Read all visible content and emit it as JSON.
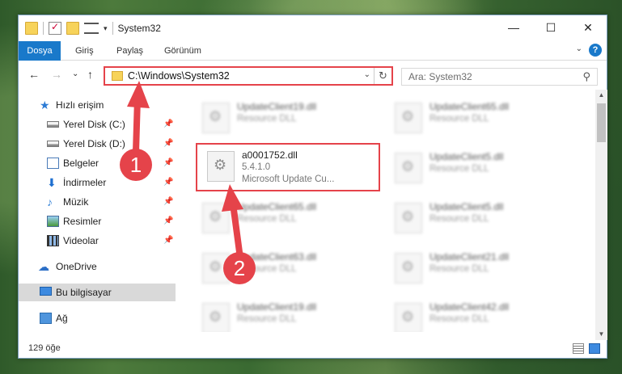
{
  "window": {
    "title": "System32",
    "controls": [
      "—",
      "☐",
      "✕"
    ]
  },
  "ribbon": {
    "tabs": [
      "Dosya",
      "Giriş",
      "Paylaş",
      "Görünüm"
    ]
  },
  "nav": {
    "back": "←",
    "forward": "→",
    "recent": "⌄",
    "up": "↑"
  },
  "address": {
    "path": "C:\\Windows\\System32"
  },
  "search": {
    "placeholder": "Ara: System32"
  },
  "sidebar": {
    "items": [
      {
        "label": "Hızlı erişim",
        "icon": "star-icon"
      },
      {
        "label": "Yerel Disk (C:)",
        "icon": "disk-icon",
        "pinned": true
      },
      {
        "label": "Yerel Disk (D:)",
        "icon": "disk-icon",
        "pinned": true
      },
      {
        "label": "Belgeler",
        "icon": "documents-icon",
        "pinned": true
      },
      {
        "label": "İndirmeler",
        "icon": "download-icon",
        "pinned": true
      },
      {
        "label": "Müzik",
        "icon": "music-icon",
        "pinned": true
      },
      {
        "label": "Resimler",
        "icon": "pictures-icon",
        "pinned": true
      },
      {
        "label": "Videolar",
        "icon": "videos-icon",
        "pinned": true
      },
      {
        "label": "OneDrive",
        "icon": "cloud-icon"
      },
      {
        "label": "Bu bilgisayar",
        "icon": "computer-icon",
        "selected": true
      },
      {
        "label": "Ağ",
        "icon": "network-icon"
      }
    ]
  },
  "files": [
    {
      "name": "UpdateClient19.dll",
      "line2": "Resource DLL"
    },
    {
      "name": "UpdateClient65.dll",
      "line2": "Resource DLL"
    },
    {
      "name": "a0001752.dll",
      "line2": "5.4.1.0",
      "line3": "Microsoft Update Cu...",
      "highlighted": true
    },
    {
      "name": "UpdateClient5.dll",
      "line2": "Resource DLL"
    },
    {
      "name": "UpdateClient65.dll",
      "line2": "Resource DLL"
    },
    {
      "name": "UpdateClient5.dll",
      "line2": "Resource DLL"
    },
    {
      "name": "UpdateClient63.dll",
      "line2": "Resource DLL"
    },
    {
      "name": "UpdateClient21.dll",
      "line2": "Resource DLL"
    },
    {
      "name": "UpdateClient19.dll",
      "line2": "Resource DLL"
    },
    {
      "name": "UpdateClient42.dll",
      "line2": "Resource DLL"
    }
  ],
  "status": {
    "item_count": "129 öğe"
  },
  "annotations": {
    "badge1": "1",
    "badge2": "2",
    "color": "#e5434a"
  },
  "colors": {
    "accent": "#1979ca",
    "highlight": "#e5434a"
  }
}
